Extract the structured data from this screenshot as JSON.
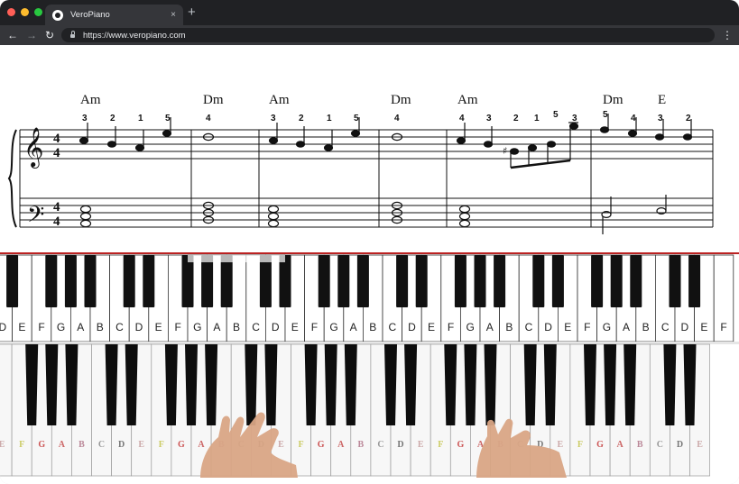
{
  "browser": {
    "tab_title": "VeroPiano",
    "tab_close": "×",
    "new_tab": "+",
    "url": "https://www.veropiano.com",
    "back": "←",
    "forward": "→",
    "reload": "↻",
    "menu": "⋮",
    "icons": [
      "back-arrow-icon",
      "forward-arrow-icon",
      "reload-icon",
      "lock-icon",
      "menu-dots-icon",
      "favicon-icon"
    ]
  },
  "sheet_music": {
    "time_signature": [
      "4",
      "4"
    ],
    "chords": [
      "Am",
      "Dm",
      "Am",
      "Dm",
      "Am",
      "Dm",
      "E"
    ],
    "fingerings": [
      "3",
      "2",
      "1",
      "5",
      "4",
      "3",
      "2",
      "1",
      "5",
      "4",
      "4",
      "3",
      "2",
      "1",
      "5",
      "3",
      "5",
      "4",
      "3",
      "2"
    ]
  },
  "keyboard_lights": {
    "labels": [
      "D",
      "E",
      "F",
      "G",
      "A",
      "B",
      "C",
      "D",
      "E",
      "F",
      "G",
      "A",
      "B",
      "C",
      "D",
      "E",
      "F",
      "G",
      "A",
      "B",
      "C",
      "D",
      "E",
      "F",
      "G",
      "A",
      "B",
      "C",
      "D",
      "E",
      "F",
      "G",
      "A",
      "B",
      "C",
      "D",
      "E",
      "F"
    ],
    "highlighted_green": [
      "A",
      "C",
      "E"
    ],
    "highlighted_purple": [
      "B"
    ],
    "green": "#7dcf3a",
    "purple": "#b57fd3"
  },
  "keyboard_stickers": {
    "labels": [
      "E",
      "F",
      "G",
      "A",
      "B",
      "C",
      "D",
      "E",
      "F",
      "G",
      "A",
      "B",
      "C",
      "D",
      "E",
      "F",
      "G",
      "A",
      "B",
      "C",
      "D",
      "E",
      "F",
      "G",
      "A",
      "B",
      "C",
      "D",
      "E",
      "F",
      "G",
      "A",
      "B",
      "C",
      "D",
      "E"
    ]
  }
}
